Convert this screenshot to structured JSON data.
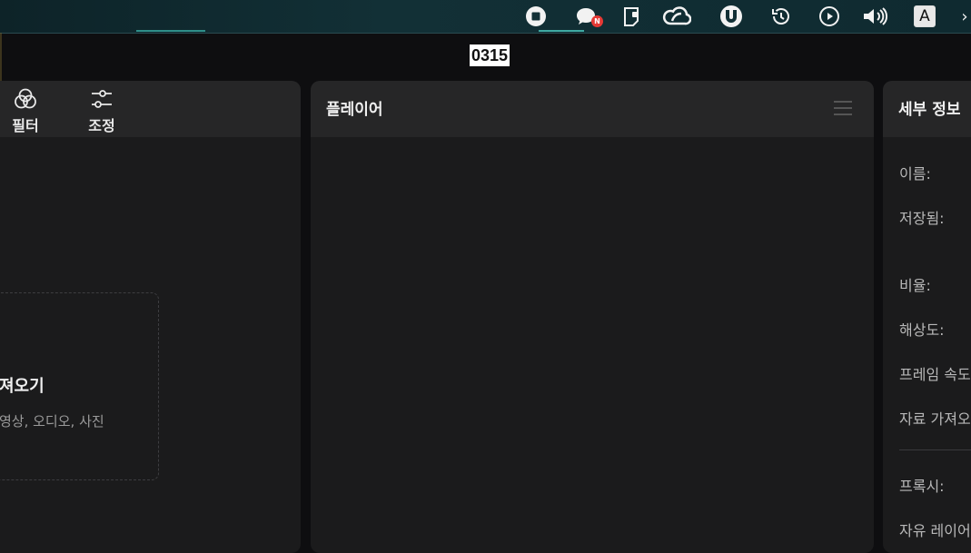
{
  "menubar": {
    "icons": [
      "stop-icon",
      "chat-icon",
      "clipboard-icon",
      "creative-cloud-icon",
      "utorrent-icon",
      "time-machine-icon",
      "play-icon",
      "volume-icon",
      "input-source-icon"
    ],
    "badge": "N",
    "input_source": "A",
    "overflow": "›"
  },
  "project": {
    "title": "0315"
  },
  "left_panel": {
    "tools": [
      {
        "label": "필터",
        "icon": "filters-icon"
      },
      {
        "label": "조정",
        "icon": "adjust-sliders-icon"
      }
    ],
    "import": {
      "title": "져오기",
      "subtitle": "영상, 오디오, 사진"
    }
  },
  "player_panel": {
    "title": "플레이어"
  },
  "details_panel": {
    "title": "세부 정보",
    "rows": [
      "이름:",
      "저장됨:",
      "비율:",
      "해상도:",
      "프레임 속도",
      "자료 가져오",
      "프록시:",
      "자유 레이어"
    ]
  }
}
